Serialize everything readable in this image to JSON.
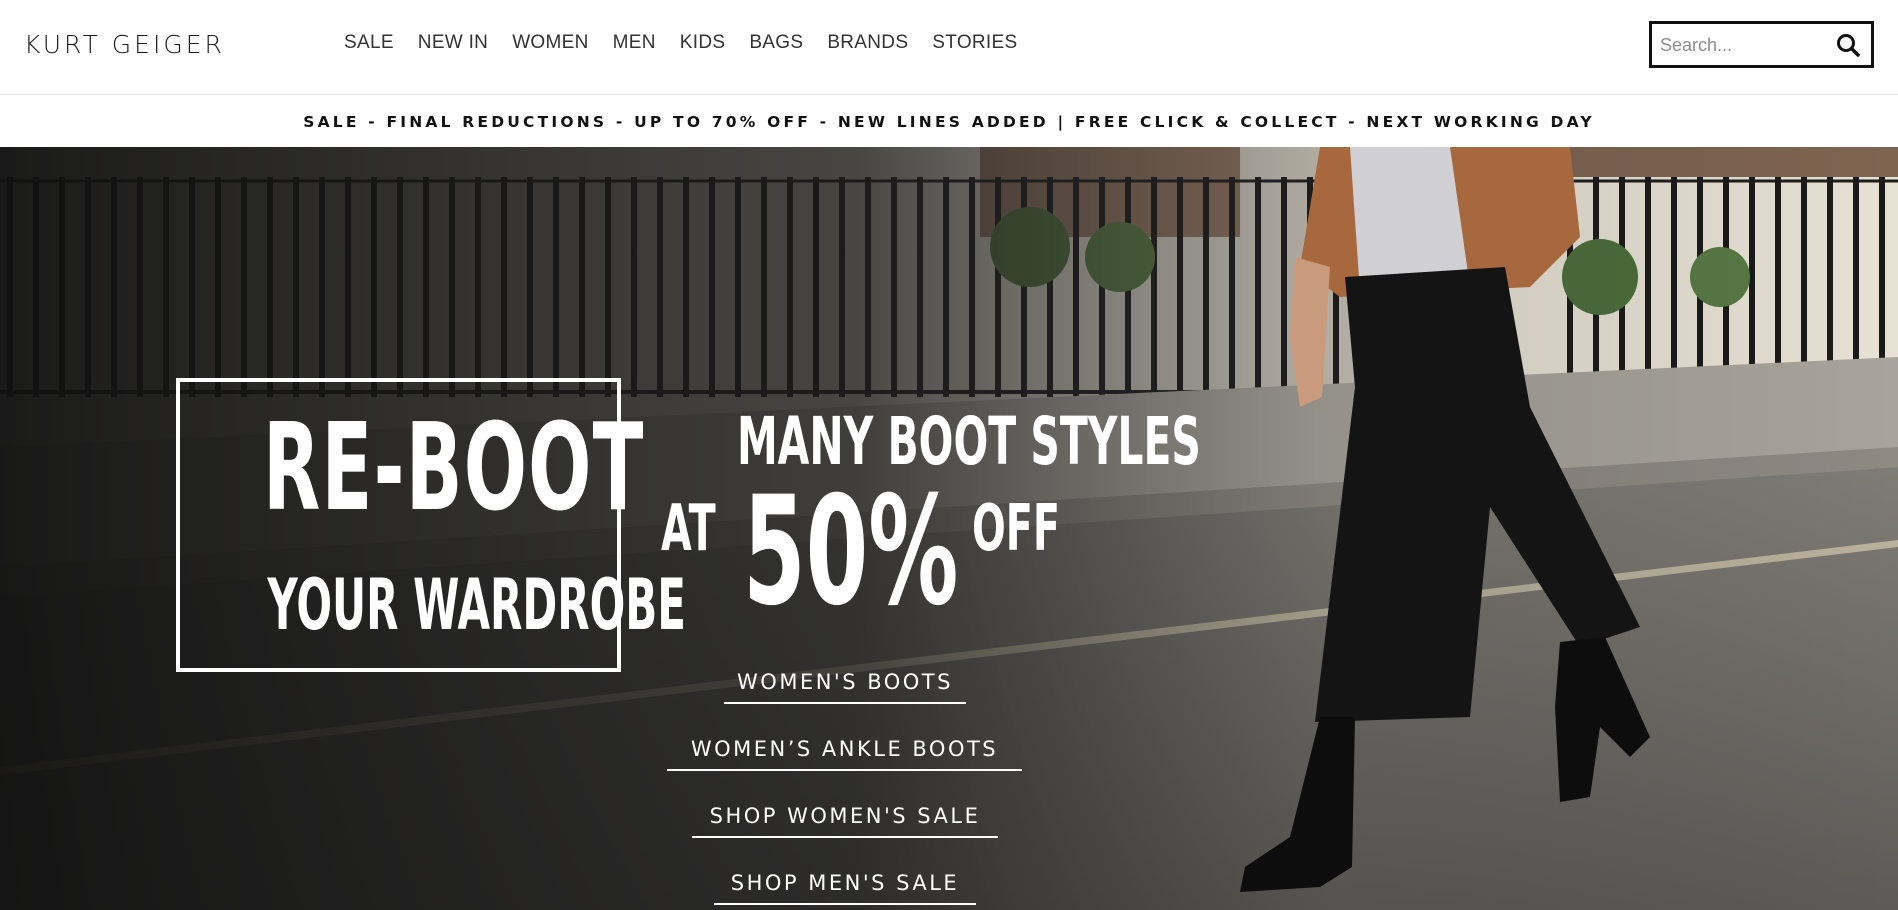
{
  "header": {
    "logo": "KURT GEIGER",
    "nav": [
      "SALE",
      "NEW IN",
      "WOMEN",
      "MEN",
      "KIDS",
      "BAGS",
      "BRANDS",
      "STORIES"
    ],
    "search": {
      "placeholder": "Search...",
      "icon": "search-icon"
    }
  },
  "promo": {
    "text": "SALE - FINAL REDUCTIONS - UP TO 70% OFF - NEW LINES ADDED | FREE CLICK & COLLECT - NEXT WORKING DAY"
  },
  "hero": {
    "box_title": "RE-BOOT",
    "box_subtitle": "YOUR WARDROBE",
    "offer_line1": "MANY BOOT STYLES",
    "offer_at": "AT",
    "offer_percent": "50%",
    "offer_off": "OFF",
    "links": [
      "WOMEN'S BOOTS",
      "WOMEN’S ANKLE BOOTS",
      "SHOP WOMEN'S SALE",
      "SHOP MEN'S SALE"
    ]
  },
  "colors": {
    "brand_text": "#1a1a1a",
    "hero_text": "#ffffff",
    "jacket": "#a8683d",
    "trousers": "#141414"
  }
}
